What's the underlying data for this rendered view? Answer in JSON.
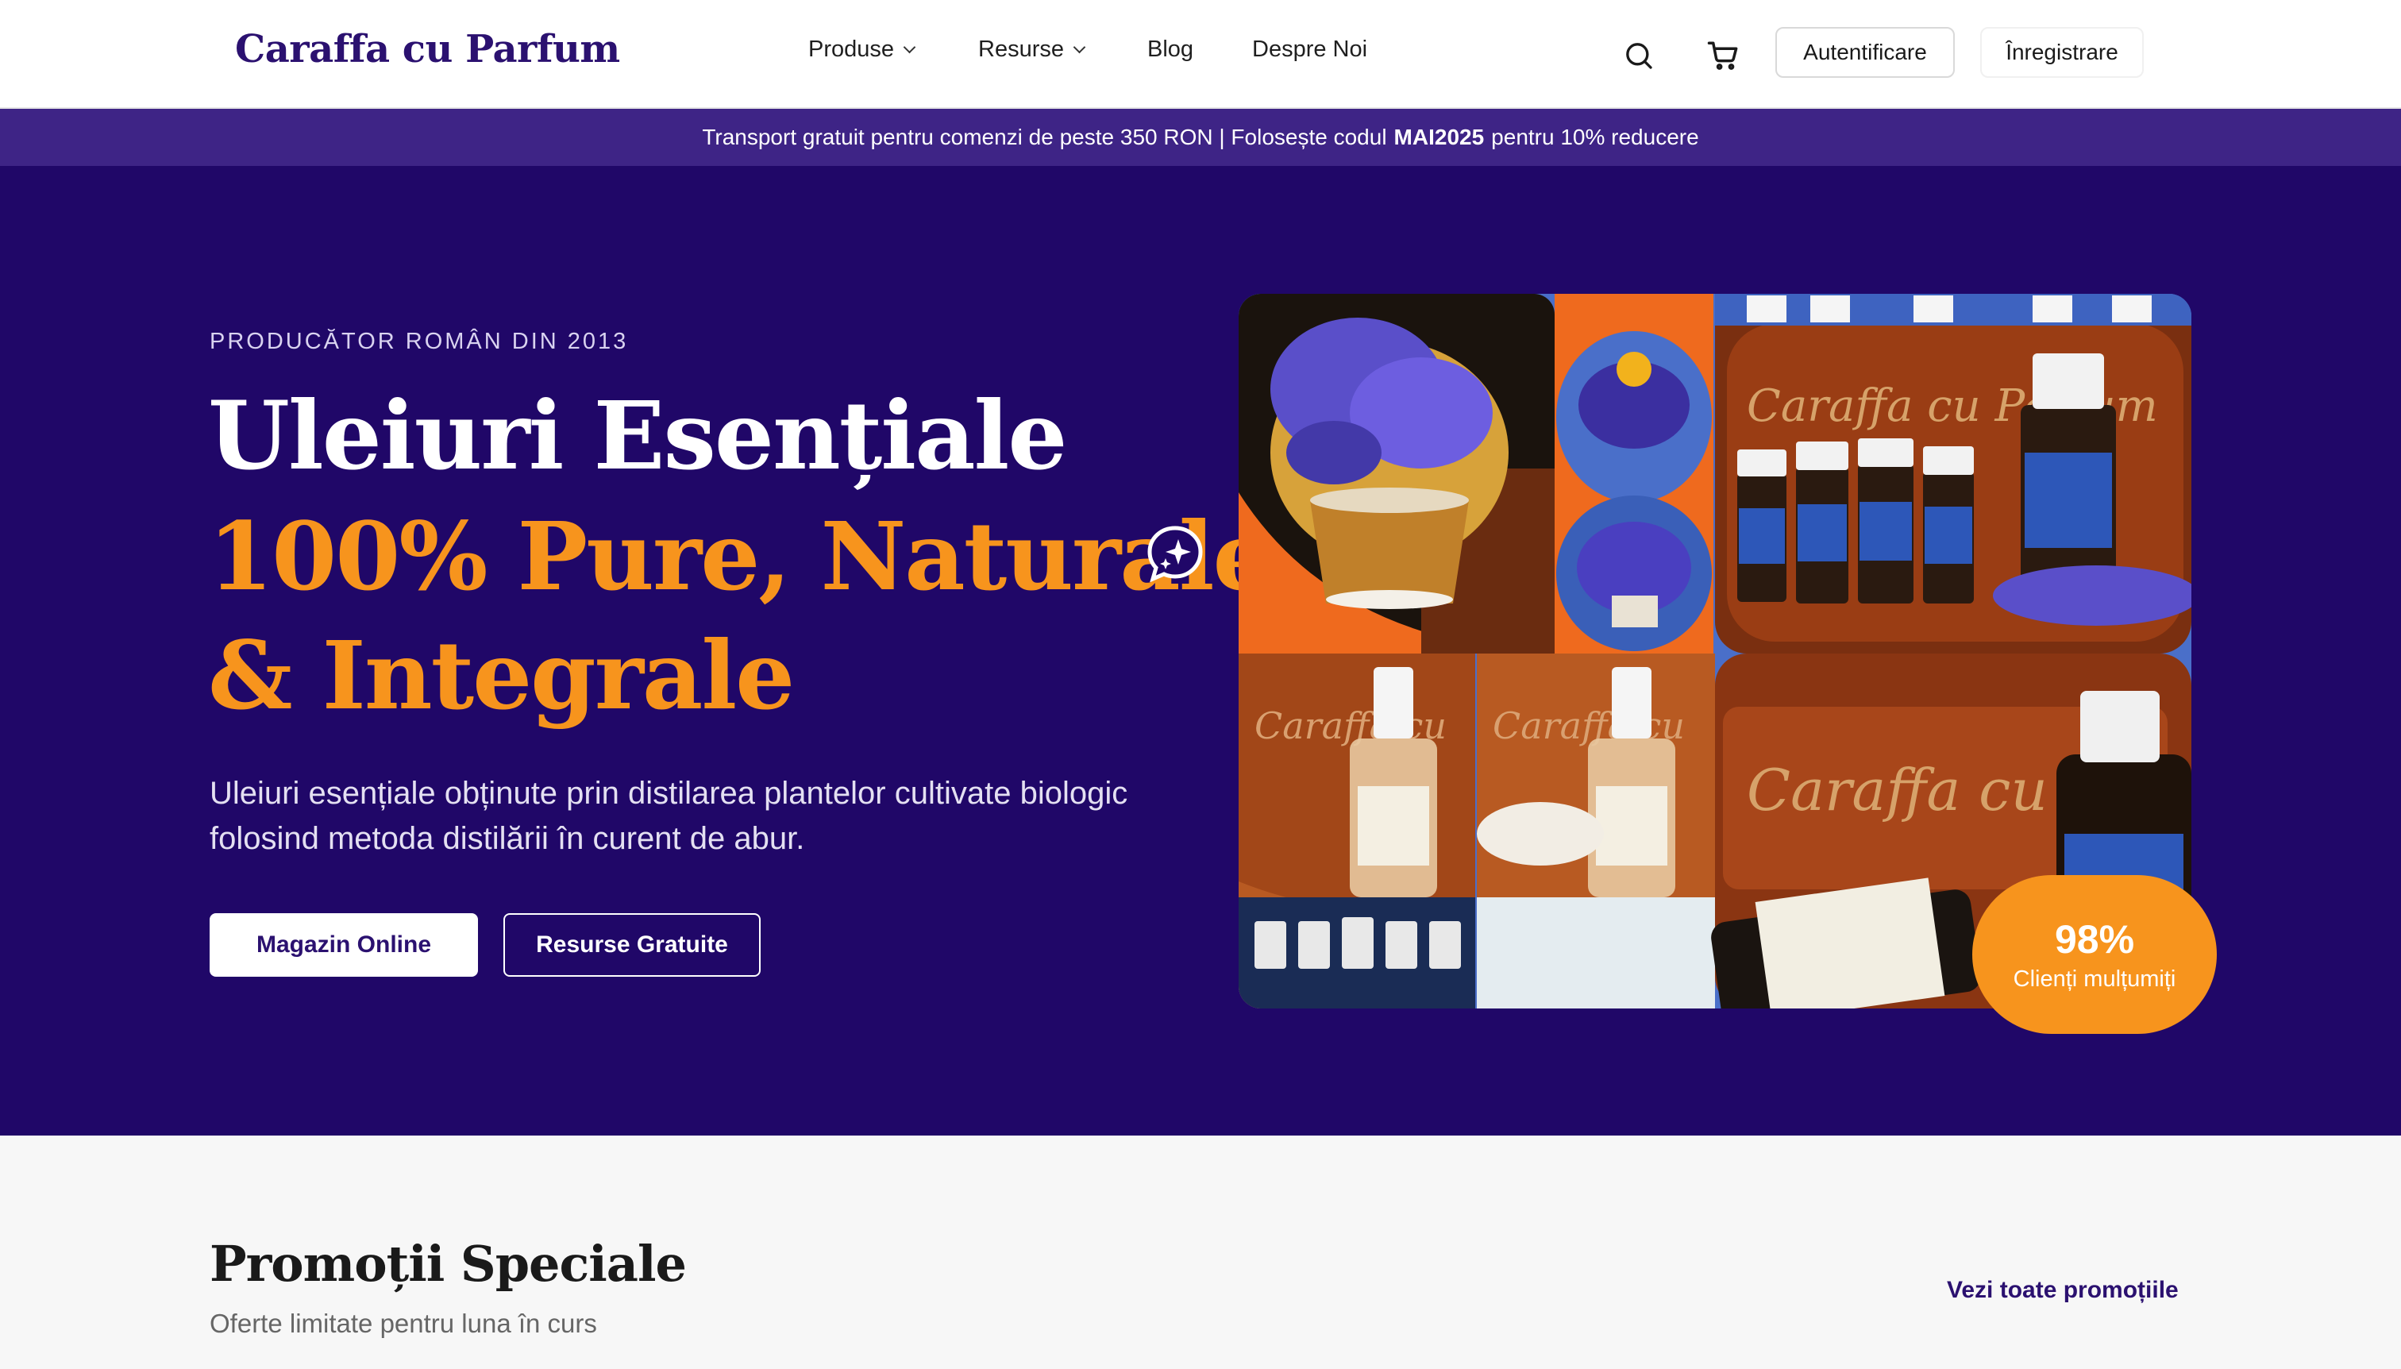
{
  "header": {
    "logo": "Caraffa cu Parfum",
    "nav": [
      {
        "label": "Produse",
        "dropdown": true
      },
      {
        "label": "Resurse",
        "dropdown": true
      },
      {
        "label": "Blog",
        "dropdown": false
      },
      {
        "label": "Despre Noi",
        "dropdown": false
      }
    ],
    "icons": [
      "search-icon",
      "cart-icon"
    ],
    "login_label": "Autentificare",
    "register_label": "Înregistrare"
  },
  "promo_bar": {
    "text_before": "Transport gratuit pentru comenzi de peste 350 RON | Folosește codul",
    "code": "MAI2025",
    "text_after": "pentru 10% reducere"
  },
  "hero": {
    "eyebrow": "PRODUCĂTOR ROMÂN DIN 2013",
    "title_line1": "Uleiuri Esențiale",
    "title_line2": "100% Pure, Naturale",
    "title_line3": "& Integrale",
    "description": "Uleiuri esențiale obținute prin distilarea plantelor cultivate biologic folosind metoda distilării în curent de abur.",
    "primary_button": "Magazin Online",
    "secondary_button": "Resurse Gratuite",
    "badge_value": "98%",
    "badge_label": "Clienți mulțumiți",
    "collage_text": "Caraffa cu Parfum"
  },
  "promotions": {
    "title": "Promoții Speciale",
    "subtitle": "Oferte limitate pentru luna în curs",
    "see_all": "Vezi toate promoțiile"
  },
  "colors": {
    "brand_purple": "#2b1170",
    "hero_bg": "#200768",
    "promo_bar_bg": "#3e2486",
    "accent_orange": "#f7941d"
  }
}
